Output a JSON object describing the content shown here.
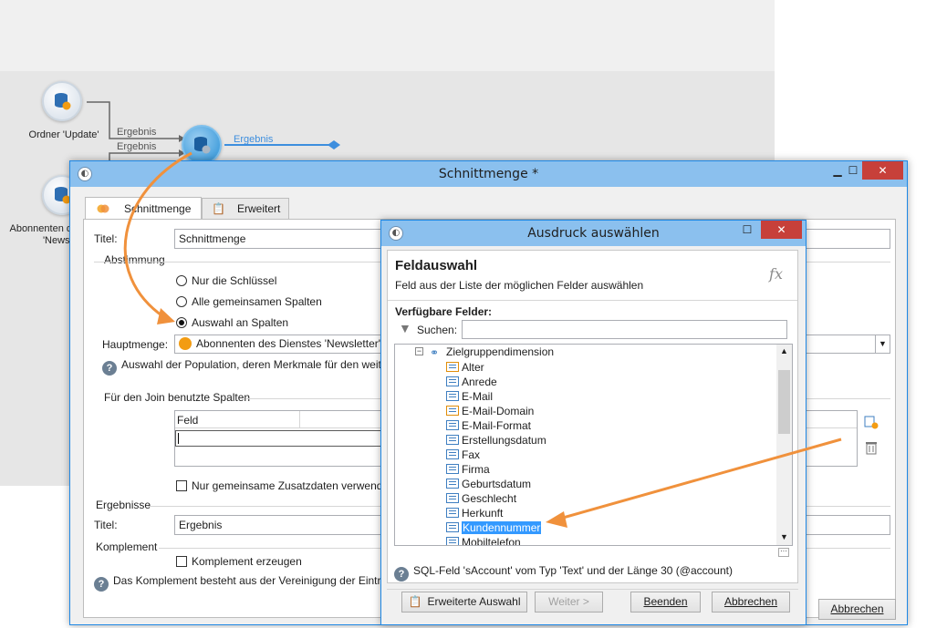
{
  "workflow": {
    "node1_label": "Ordner 'Update'",
    "node2_label": "Abonnenten d\n'Newsl",
    "edge1_label": "Ergebnis",
    "edge2_label": "Ergebnis",
    "out_label": "Ergebnis"
  },
  "main_window": {
    "title": "Schnittmenge *",
    "tabs": [
      {
        "label": "Schnittmenge"
      },
      {
        "label": "Erweitert"
      }
    ],
    "titel_label": "Titel:",
    "titel_value": "Schnittmenge",
    "abstimmung_label": "Abstimmung",
    "radios": [
      {
        "label": "Nur die Schlüssel",
        "checked": false
      },
      {
        "label": "Alle gemeinsamen Spalten",
        "checked": false
      },
      {
        "label": "Auswahl an Spalten",
        "checked": true
      }
    ],
    "hauptmenge_label": "Hauptmenge:",
    "hauptmenge_value": "Abonnenten des Dienstes 'Newsletter'",
    "population_help": "Auswahl der Population, deren Merkmale für den weit",
    "join_label": "Für den Join benutzte Spalten",
    "join_column_header": "Feld",
    "nur_gemeinsame_label": "Nur gemeinsame Zusatzdaten verwende",
    "ergebnisse_label": "Ergebnisse",
    "ergebnis_titel_label": "Titel:",
    "ergebnis_titel_value": "Ergebnis",
    "komplement_label": "Komplement",
    "komplement_checkbox": "Komplement erzeugen",
    "komplement_help": "Das Komplement besteht aus der Vereinigung der Einträ",
    "cancel_button": "Abbrechen"
  },
  "dialog": {
    "title": "Ausdruck auswählen",
    "heading": "Feldauswahl",
    "subheading": "Feld aus der Liste der möglichen Felder auswählen",
    "fx_icon_text": "fx",
    "available_label": "Verfügbare Felder:",
    "search_label": "Suchen:",
    "search_value": "",
    "tree_root": "Zielgruppendimension",
    "tree_items": [
      {
        "label": "Alter"
      },
      {
        "label": "Anrede"
      },
      {
        "label": "E-Mail"
      },
      {
        "label": "E-Mail-Domain"
      },
      {
        "label": "E-Mail-Format"
      },
      {
        "label": "Erstellungsdatum"
      },
      {
        "label": "Fax"
      },
      {
        "label": "Firma"
      },
      {
        "label": "Geburtsdatum"
      },
      {
        "label": "Geschlecht"
      },
      {
        "label": "Herkunft"
      },
      {
        "label": "Kundennummer"
      },
      {
        "label": "Mobiltelefon"
      }
    ],
    "field_info": "SQL-Feld 'sAccount' vom Typ 'Text' und der Länge 30 (@account)",
    "btn_advanced": "Erweiterte Auswahl",
    "btn_next": "Weiter >",
    "btn_finish": "Beenden",
    "btn_cancel": "Abbrechen"
  },
  "colors": {
    "accent": "#1e88e5",
    "titlebar": "#8bc0ee",
    "close": "#c7403a",
    "arrow": "#f0913c",
    "selection": "#3399ff"
  }
}
